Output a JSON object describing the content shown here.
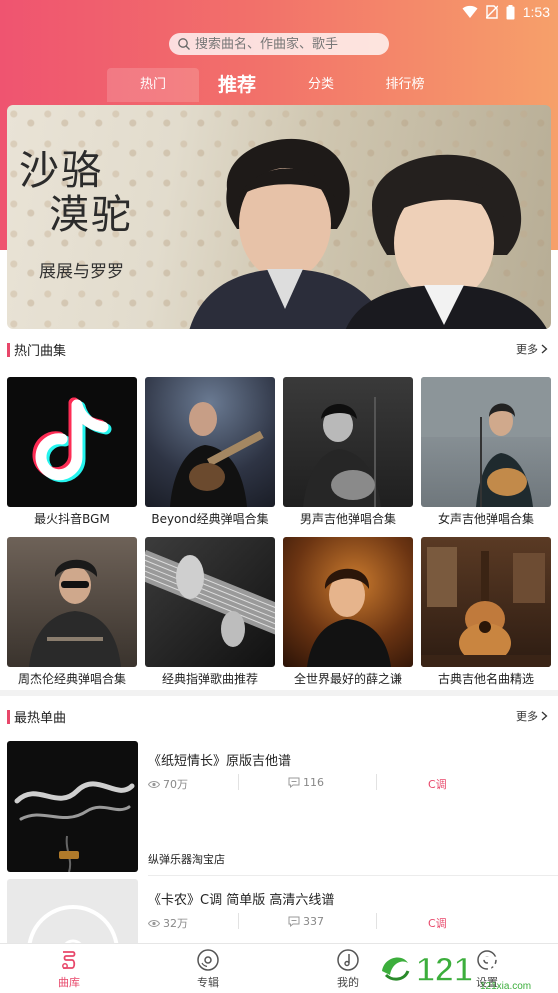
{
  "status": {
    "time": "1:53"
  },
  "search": {
    "placeholder": "搜索曲名、作曲家、歌手"
  },
  "tabs": [
    {
      "label": "热门"
    },
    {
      "label": "推荐"
    },
    {
      "label": "分类"
    },
    {
      "label": "排行榜"
    }
  ],
  "banner": {
    "title_line1": "沙骆",
    "title_line2": "漠驼",
    "artist": "展展与罗罗"
  },
  "hot_collections": {
    "title": "热门曲集",
    "more": "更多",
    "items": [
      {
        "label": "最火抖音BGM"
      },
      {
        "label": "Beyond经典弹唱合集"
      },
      {
        "label": "男声吉他弹唱合集"
      },
      {
        "label": "女声吉他弹唱合集"
      },
      {
        "label": "周杰伦经典弹唱合集"
      },
      {
        "label": "经典指弹歌曲推荐"
      },
      {
        "label": "全世界最好的薛之谦"
      },
      {
        "label": "古典吉他名曲精选"
      }
    ]
  },
  "hot_singles": {
    "title": "最热单曲",
    "more": "更多",
    "items": [
      {
        "title": "《纸短情长》原版吉他谱",
        "views": "70万",
        "comments": "116",
        "key": "C调",
        "shop": "纵弹乐器淘宝店"
      },
      {
        "title": "《卡农》C调 简单版 高清六线谱",
        "views": "32万",
        "comments": "337",
        "key": "C调"
      }
    ]
  },
  "bottom_nav": [
    {
      "label": "曲库",
      "icon": "music-library-icon"
    },
    {
      "label": "专辑",
      "icon": "album-icon"
    },
    {
      "label": "我的",
      "icon": "my-icon"
    },
    {
      "label": "设置",
      "icon": "settings-icon"
    }
  ],
  "watermark": {
    "text": "121下载站",
    "sub": "121xia.com"
  },
  "colors": {
    "accent": "#e8476a",
    "header_start": "#ef5470",
    "header_end": "#f6a06a"
  }
}
